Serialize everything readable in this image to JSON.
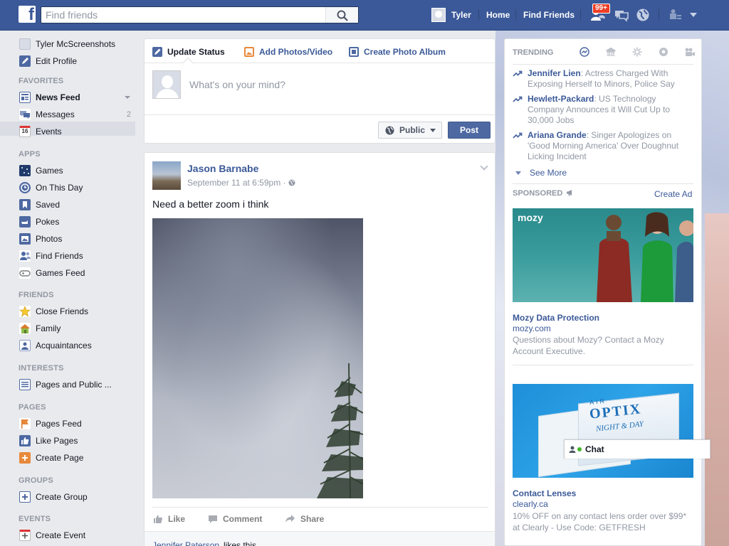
{
  "topbar": {
    "logo": "f",
    "search_placeholder": "Find friends",
    "user_name": "Tyler",
    "nav_home": "Home",
    "nav_find_friends": "Find Friends",
    "friend_requests_badge": "99+",
    "icons": [
      "facebook-logo-icon",
      "search-icon",
      "friend-requests-icon",
      "messages-icon",
      "notifications-globe-icon",
      "privacy-shortcuts-icon",
      "account-caret-icon"
    ]
  },
  "sidebar": {
    "profile_name": "Tyler McScreenshots",
    "edit_profile": "Edit Profile",
    "favorites_head": "FAVORITES",
    "news_feed": "News Feed",
    "messages": "Messages",
    "messages_count": "2",
    "events": "Events",
    "events_icon_text": "16",
    "apps_head": "APPS",
    "apps": [
      "Games",
      "On This Day",
      "Saved",
      "Pokes",
      "Photos",
      "Find Friends",
      "Games Feed"
    ],
    "friends_head": "FRIENDS",
    "friends": [
      "Close Friends",
      "Family",
      "Acquaintances"
    ],
    "interests_head": "INTERESTS",
    "interests": [
      "Pages and Public ..."
    ],
    "pages_head": "PAGES",
    "pages": [
      "Pages Feed",
      "Like Pages",
      "Create Page"
    ],
    "groups_head": "GROUPS",
    "groups": [
      "Create Group"
    ],
    "events_head": "EVENTS",
    "events_items": [
      "Create Event"
    ]
  },
  "composer": {
    "tab_status": "Update Status",
    "tab_photos": "Add Photos/Video",
    "tab_album": "Create Photo Album",
    "placeholder": "What's on your mind?",
    "audience": "Public",
    "post_button": "Post"
  },
  "story": {
    "author": "Jason Barnabe",
    "time": "September 11 at 6:59pm · ",
    "text": "Need a better zoom i think",
    "like": "Like",
    "comment": "Comment",
    "share": "Share",
    "liker": "Jennifer Paterson",
    "likes_suffix": "likes this."
  },
  "trending": {
    "head": "TRENDING",
    "items": [
      {
        "name": "Jennifer Lien",
        "desc": ": Actress Charged With Exposing Herself to Minors, Police Say"
      },
      {
        "name": "Hewlett-Packard",
        "desc": ": US Technology Company Announces it Will Cut Up to 30,000 Jobs"
      },
      {
        "name": "Ariana Grande",
        "desc": ": Singer Apologizes on 'Good Morning America' Over Doughnut Licking Incident"
      }
    ],
    "see_more": "See More"
  },
  "sponsored": {
    "head": "SPONSORED",
    "create_ad": "Create Ad",
    "ads": [
      {
        "logo": "mozy",
        "title": "Mozy Data Protection",
        "url": "mozy.com",
        "desc": "Questions about Mozy? Contact a Mozy Account Executive."
      },
      {
        "logo_air": "AIR",
        "logo_optix": "OPTIX",
        "logo_nightday": "NIGHT & DAY",
        "title": "Contact Lenses",
        "url": "clearly.ca",
        "desc": "10% OFF on any contact lens order over $99* at Clearly - Use Code: GETFRESH"
      }
    ]
  },
  "chat": {
    "label": "Chat"
  },
  "colors": {
    "brand": "#3b5998",
    "link": "#3b5998",
    "muted": "#9197a3",
    "badge": "#f03d25"
  }
}
